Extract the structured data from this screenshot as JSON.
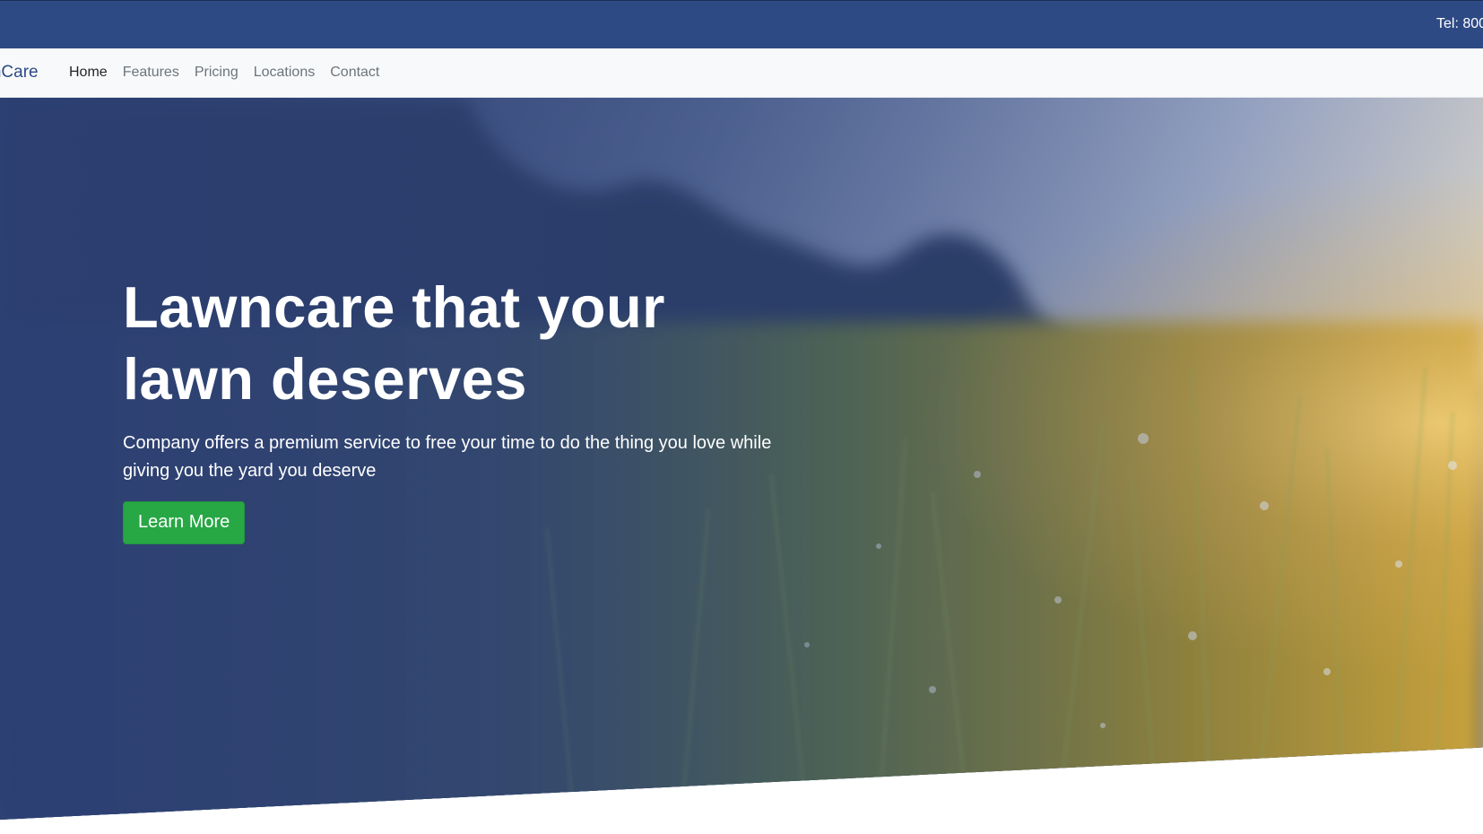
{
  "topbar": {
    "tel": "Tel: 800"
  },
  "navbar": {
    "brand": "LawnCare",
    "links": [
      {
        "label": "Home",
        "active": true
      },
      {
        "label": "Features",
        "active": false
      },
      {
        "label": "Pricing",
        "active": false
      },
      {
        "label": "Locations",
        "active": false
      },
      {
        "label": "Contact",
        "active": false
      }
    ]
  },
  "hero": {
    "title": "Lawncare that your lawn deserves",
    "subtitle": "Company offers a premium service to free your time to do the thing you love while giving you the yard you deserve",
    "cta_label": "Learn More",
    "background_image": "dewy-grass-at-sunrise"
  },
  "colors": {
    "topbar": "#2e4a85",
    "brand": "#2e4a85",
    "navbar_bg": "#f8f9fa",
    "cta": "#28a745",
    "overlay": "#2c3f73"
  }
}
